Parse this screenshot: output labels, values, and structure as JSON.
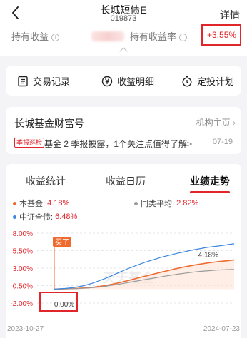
{
  "header": {
    "title": "长城短债E",
    "code": "019873",
    "detail_label": "详情"
  },
  "holding": {
    "income_label": "持有收益",
    "rate_label": "持有收益率",
    "rate_value": "+3.55%"
  },
  "actions": {
    "records": "交易记录",
    "income_detail": "收益明细",
    "auto_invest": "定投计划"
  },
  "info_card": {
    "title": "长城基金财富号",
    "link": "机构主页",
    "badge": "季报巡检",
    "news": "基金 2 季报披露，1个关注点值得了解>",
    "date": "07-19"
  },
  "tabs": {
    "t1": "收益统计",
    "t2": "收益日历",
    "t3": "业绩走势"
  },
  "legend": {
    "fund_label": "本基金:",
    "fund_value": "4.18%",
    "peer_label": "同类平均:",
    "peer_value": "2.82%",
    "index_label": "中证全债:",
    "index_value": "6.48%"
  },
  "colors": {
    "accent": "#e0252b",
    "fund": "#ef6a2f",
    "peer": "#9a9a9a",
    "index": "#3b86e0"
  },
  "chart_data": {
    "type": "line",
    "yticks": [
      "8.00%",
      "5.50%",
      "3.00%",
      "0.50%",
      "-2.00%"
    ],
    "ylim": [
      -2.0,
      8.0
    ],
    "x_start": "2023-10-27",
    "x_end": "2024-07-23",
    "buy_label": "买了",
    "start_label": "0.00%",
    "end_label": "4.18%",
    "watermark": "天天基金",
    "series": [
      {
        "name": "本基金",
        "values": [
          0.0,
          0.02,
          0.05,
          0.07,
          0.1,
          0.15,
          0.2,
          0.28,
          0.38,
          0.5,
          0.65,
          0.82,
          1.0,
          1.2,
          1.4,
          1.62,
          1.82,
          2.02,
          2.22,
          2.42,
          2.6,
          2.8,
          2.98,
          3.15,
          3.3,
          3.45,
          3.58,
          3.7,
          3.82,
          3.92,
          4.0,
          4.08,
          4.18
        ]
      },
      {
        "name": "同类平均",
        "values": [
          0.0,
          0.02,
          0.04,
          0.06,
          0.08,
          0.12,
          0.16,
          0.22,
          0.3,
          0.4,
          0.52,
          0.64,
          0.78,
          0.92,
          1.06,
          1.2,
          1.35,
          1.48,
          1.62,
          1.76,
          1.9,
          2.02,
          2.14,
          2.26,
          2.36,
          2.46,
          2.54,
          2.6,
          2.66,
          2.72,
          2.76,
          2.8,
          2.82
        ]
      },
      {
        "name": "中证全债",
        "values": [
          0.0,
          0.05,
          0.1,
          0.18,
          0.3,
          0.45,
          0.65,
          0.9,
          1.2,
          1.5,
          1.85,
          2.2,
          2.55,
          2.9,
          3.2,
          3.5,
          3.8,
          4.05,
          4.3,
          4.55,
          4.75,
          4.95,
          5.15,
          5.3,
          5.5,
          5.65,
          5.8,
          5.95,
          6.05,
          6.15,
          6.25,
          6.38,
          6.48
        ]
      }
    ]
  }
}
